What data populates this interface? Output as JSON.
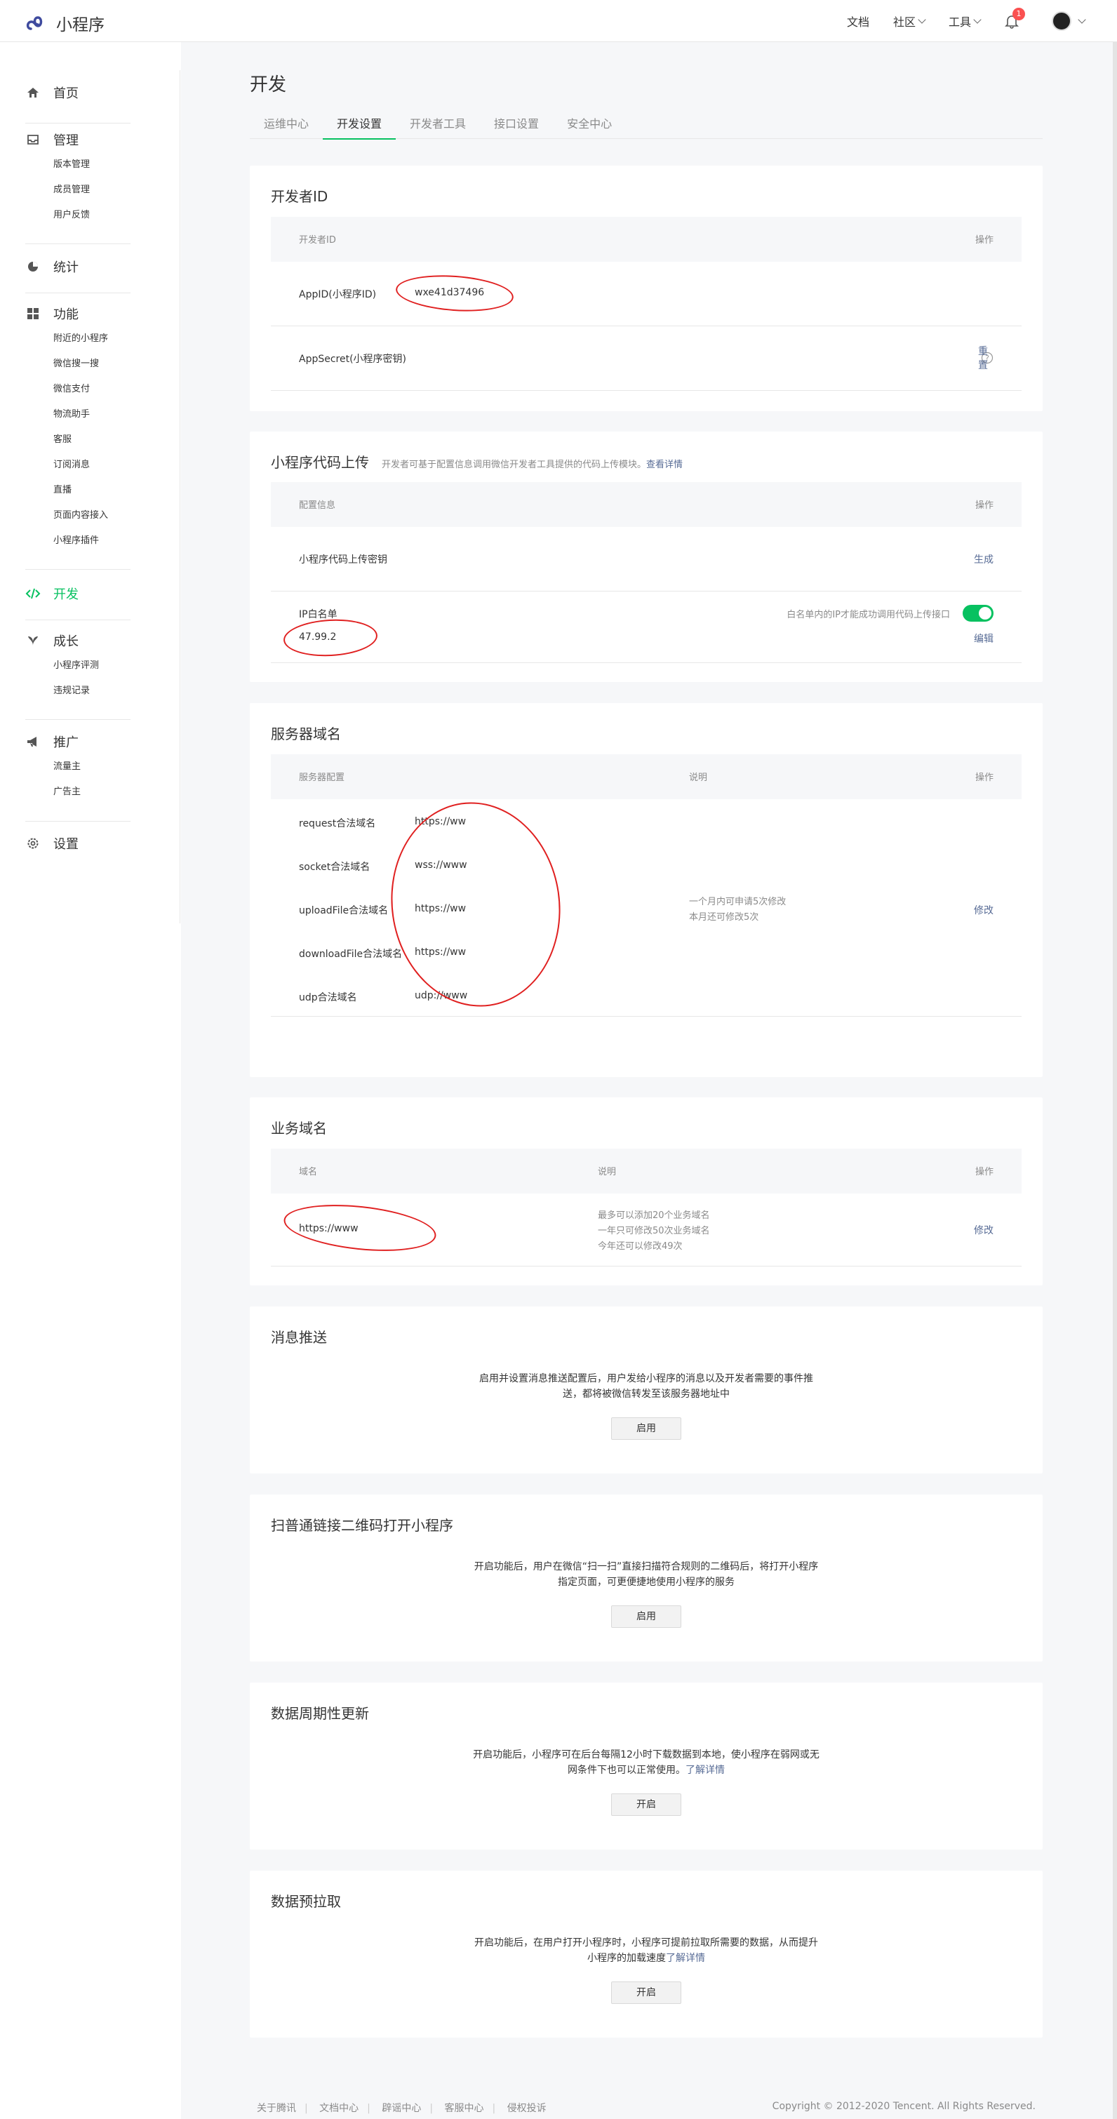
{
  "topbar": {
    "app_name": "小程序",
    "nav": {
      "docs": "文档",
      "community": "社区",
      "tools": "工具"
    },
    "notification_count": "1"
  },
  "sidebar": {
    "groups": [
      {
        "label": "首页",
        "icon": "home-icon",
        "items": []
      },
      {
        "label": "管理",
        "icon": "inbox-icon",
        "items": [
          "版本管理",
          "成员管理",
          "用户反馈"
        ]
      },
      {
        "label": "统计",
        "icon": "pie-chart-icon",
        "items": []
      },
      {
        "label": "功能",
        "icon": "grid-icon",
        "items": [
          "附近的小程序",
          "微信搜一搜",
          "微信支付",
          "物流助手",
          "客服",
          "订阅消息",
          "直播",
          "页面内容接入",
          "小程序插件"
        ]
      },
      {
        "label": "开发",
        "icon": "code-icon",
        "items": []
      },
      {
        "label": "成长",
        "icon": "leaf-icon",
        "items": [
          "小程序评测",
          "违规记录"
        ]
      },
      {
        "label": "推广",
        "icon": "megaphone-icon",
        "items": [
          "流量主",
          "广告主"
        ]
      },
      {
        "label": "设置",
        "icon": "gear-icon",
        "items": []
      }
    ],
    "active": "开发"
  },
  "page": {
    "title": "开发",
    "tabs": [
      "运维中心",
      "开发设置",
      "开发者工具",
      "接口设置",
      "安全中心"
    ],
    "active_tab": "开发设置"
  },
  "developer_id": {
    "title": "开发者ID",
    "col_name": "开发者ID",
    "col_op": "操作",
    "appid_label": "AppID(小程序ID)",
    "appid_value": "wxe41d37496",
    "secret_label": "AppSecret(小程序密钥)",
    "secret_action": "重置"
  },
  "code_upload": {
    "title": "小程序代码上传",
    "desc": "开发者可基于配置信息调用微信开发者工具提供的代码上传模块。",
    "desc_link": "查看详情",
    "col_config": "配置信息",
    "col_op": "操作",
    "key_label": "小程序代码上传密钥",
    "key_action": "生成",
    "ip_label": "IP白名单",
    "ip_value": "47.99.2",
    "ip_hint": "白名单内的IP才能成功调用代码上传接口",
    "ip_whitelist_enabled": true,
    "ip_action": "编辑"
  },
  "server_domain": {
    "title": "服务器域名",
    "col_config": "服务器配置",
    "col_desc": "说明",
    "col_op": "操作",
    "rows": [
      {
        "label": "request合法域名",
        "value": "https://ww"
      },
      {
        "label": "socket合法域名",
        "value": "wss://www"
      },
      {
        "label": "uploadFile合法域名",
        "value": "https://ww"
      },
      {
        "label": "downloadFile合法域名",
        "value": "https://ww"
      },
      {
        "label": "udp合法域名",
        "value": "udp://www"
      }
    ],
    "desc_line1": "一个月内可申请5次修改",
    "desc_line2": "本月还可修改5次",
    "action": "修改"
  },
  "business_domain": {
    "title": "业务域名",
    "col_domain": "域名",
    "col_desc": "说明",
    "col_op": "操作",
    "domain_value": "https://www",
    "desc_line1": "最多可以添加20个业务域名",
    "desc_line2": "一年只可修改50次业务域名",
    "desc_line3": "今年还可以修改49次",
    "action": "修改"
  },
  "message_push": {
    "title": "消息推送",
    "text_line1": "启用并设置消息推送配置后，用户发给小程序的消息以及开发者需要的事件推",
    "text_line2": "送，都将被微信转发至该服务器地址中",
    "button": "启用"
  },
  "qr_link": {
    "title": "扫普通链接二维码打开小程序",
    "text_line1": "开启功能后，用户在微信“扫一扫”直接扫描符合规则的二维码后，将打开小程序",
    "text_line2": "指定页面，可更便捷地使用小程序的服务",
    "button": "启用"
  },
  "periodic_update": {
    "title": "数据周期性更新",
    "text_line1": "开启功能后，小程序可在后台每隔12小时下载数据到本地，使小程序在弱网或无",
    "text_line2": "网条件下也可以正常使用。",
    "link": "了解详情",
    "button": "开启"
  },
  "prefetch": {
    "title": "数据预拉取",
    "text_line1": "开启功能后，在用户打开小程序时，小程序可提前拉取所需要的数据，从而提升",
    "text_line2": "小程序的加载速度",
    "link": "了解详情",
    "button": "开启"
  },
  "footer": {
    "links": [
      "关于腾讯",
      "文档中心",
      "辟谣中心",
      "客服中心",
      "侵权投诉"
    ],
    "copyright": "Copyright © 2012-2020 Tencent. All Rights Reserved."
  }
}
